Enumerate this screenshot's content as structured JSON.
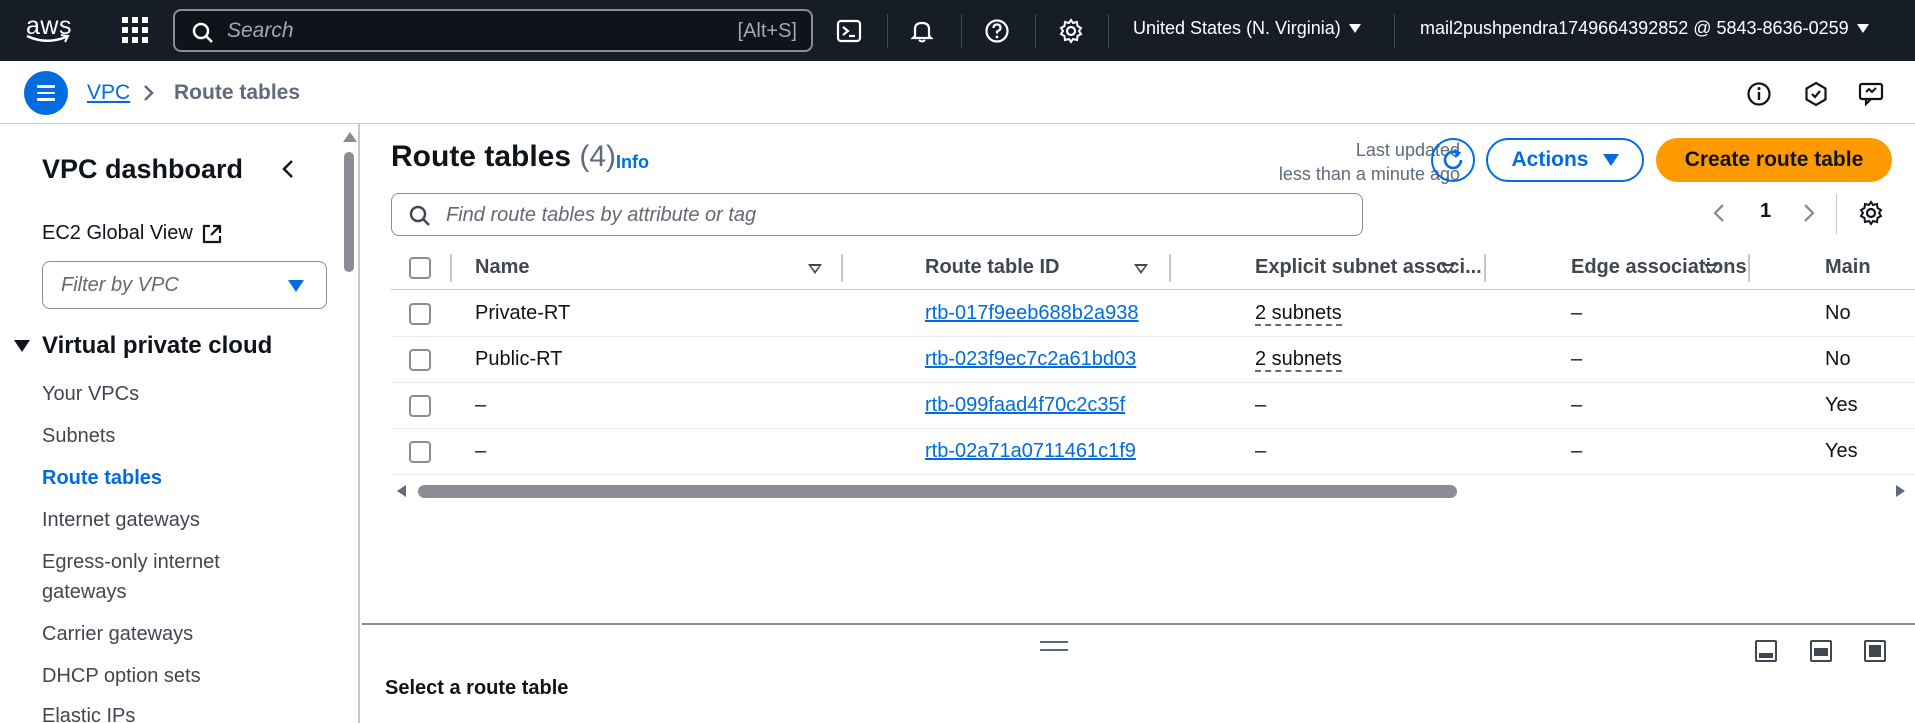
{
  "topnav": {
    "logo_text": "aws",
    "search_placeholder": "Search",
    "search_shortcut": "[Alt+S]",
    "icons": [
      "cloudshell-icon",
      "bell-icon",
      "help-icon",
      "gear-icon"
    ],
    "region": "United States (N. Virginia)",
    "account": "mail2pushpendra1749664392852 @ 5843-8636-0259"
  },
  "breadcrumb": {
    "root": "VPC",
    "current": "Route tables"
  },
  "sidebar": {
    "title": "VPC dashboard",
    "ec2_global_view": "EC2 Global View",
    "filter_placeholder": "Filter by VPC",
    "section": "Virtual private cloud",
    "items": [
      {
        "label": "Your VPCs",
        "active": false
      },
      {
        "label": "Subnets",
        "active": false
      },
      {
        "label": "Route tables",
        "active": true
      },
      {
        "label": "Internet gateways",
        "active": false
      },
      {
        "label": "Egress-only internet gateways",
        "active": false
      },
      {
        "label": "Carrier gateways",
        "active": false
      },
      {
        "label": "DHCP option sets",
        "active": false
      },
      {
        "label": "Elastic IPs",
        "active": false
      }
    ]
  },
  "main": {
    "title": "Route tables",
    "count": "(4)",
    "info": "Info",
    "last_updated_line1": "Last updated",
    "last_updated_line2": "less than a minute ago",
    "actions_label": "Actions",
    "create_label": "Create route table",
    "filter_placeholder": "Find route tables by attribute or tag",
    "page": "1"
  },
  "table": {
    "columns": [
      "Name",
      "Route table ID",
      "Explicit subnet associ...",
      "Edge associations",
      "Main"
    ],
    "rows": [
      {
        "name": "Private-RT",
        "id": "rtb-017f9eeb688b2a938",
        "subnets": "2 subnets",
        "edge": "–",
        "main": "No"
      },
      {
        "name": "Public-RT",
        "id": "rtb-023f9ec7c2a61bd03",
        "subnets": "2 subnets",
        "edge": "–",
        "main": "No"
      },
      {
        "name": "–",
        "id": "rtb-099faad4f70c2c35f",
        "subnets": "–",
        "edge": "–",
        "main": "Yes"
      },
      {
        "name": "–",
        "id": "rtb-02a71a0711461c1f9",
        "subnets": "–",
        "edge": "–",
        "main": "Yes"
      }
    ]
  },
  "split_panel": {
    "title": "Select a route table"
  },
  "colors": {
    "nav_bg": "#161d26",
    "link": "#006ce0",
    "primary_button": "#ff9900"
  }
}
